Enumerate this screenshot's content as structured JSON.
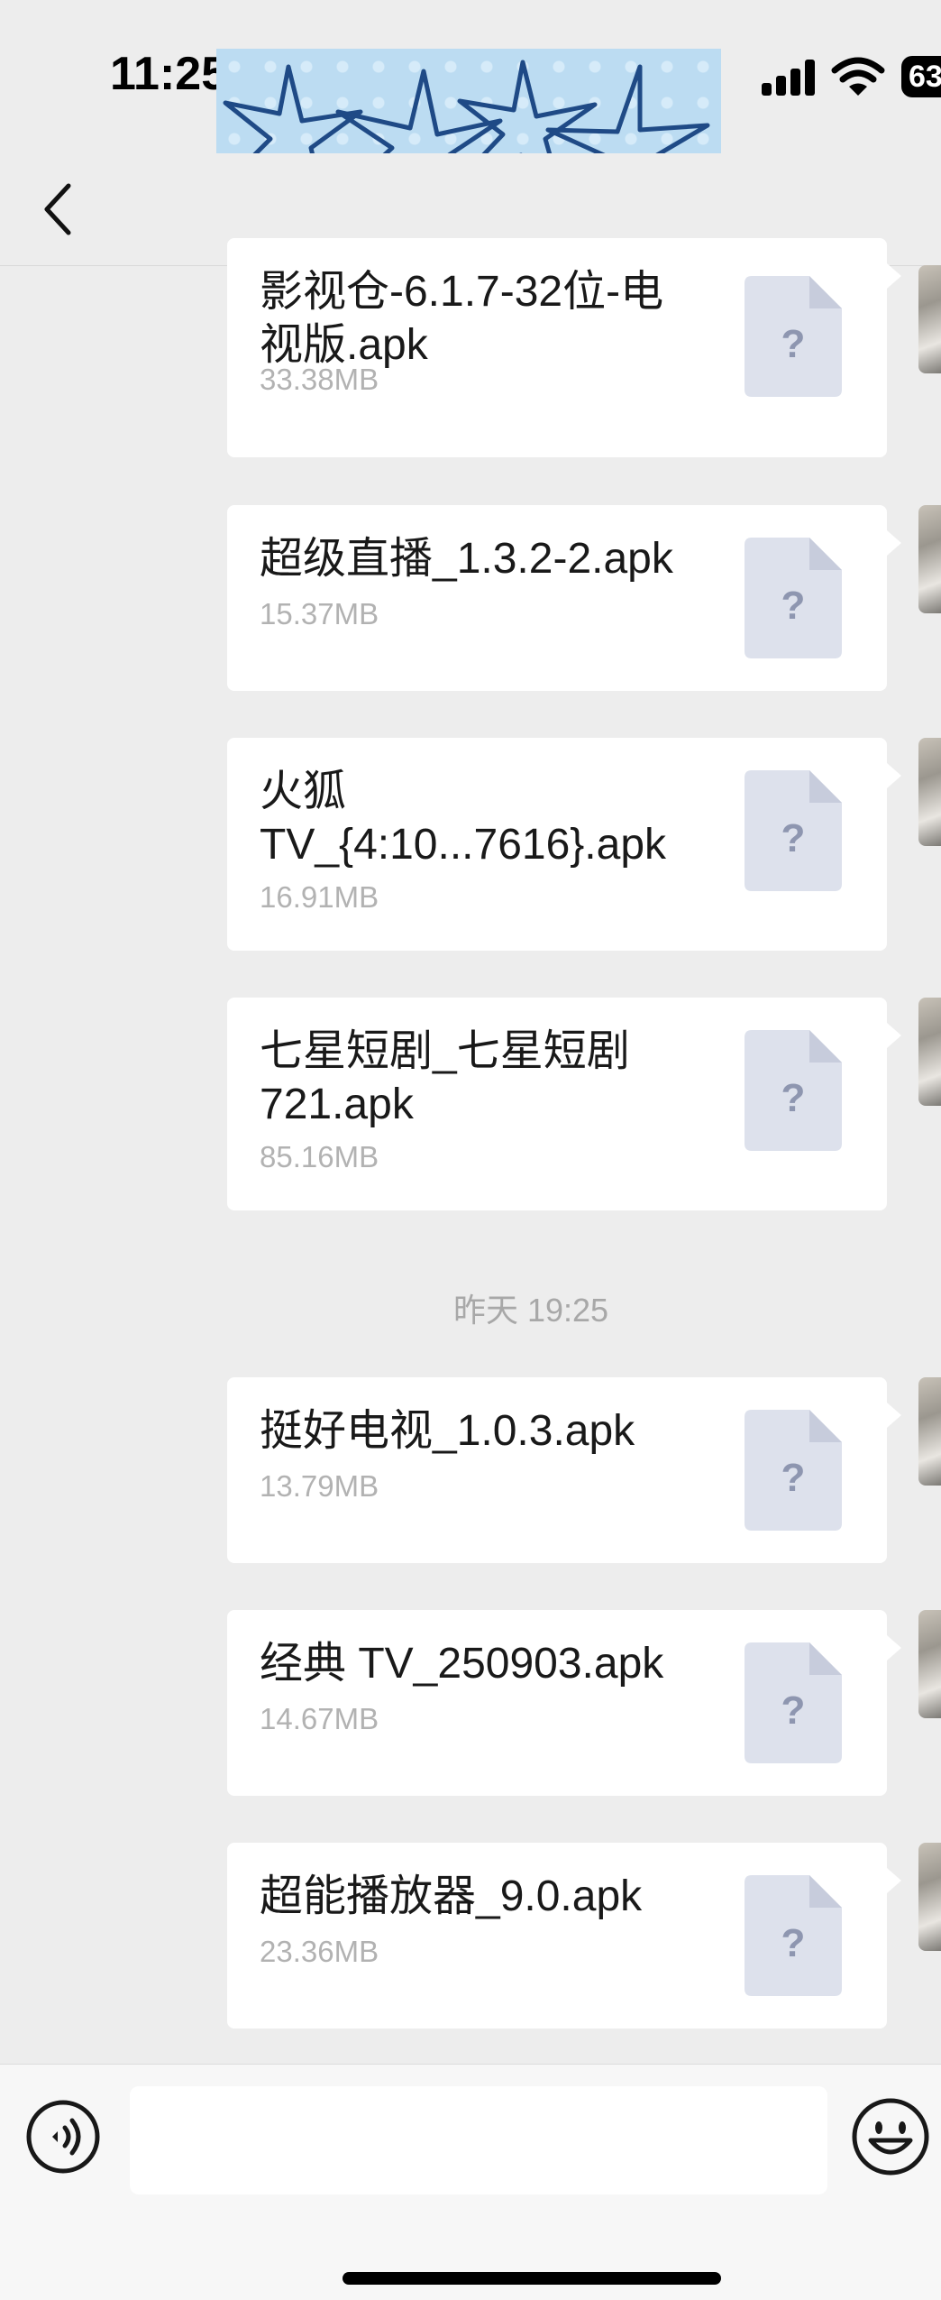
{
  "status_bar": {
    "time": "11:25",
    "battery_level": "63"
  },
  "nav": {
    "back_icon": "chevron-left-icon"
  },
  "messages": [
    {
      "name": "影视仓-6.1.7-32位-电视版.apk",
      "size": "33.38MB"
    },
    {
      "name": "超级直播_1.3.2-2.apk",
      "size": "15.37MB"
    },
    {
      "name": "火狐 TV_{4:10...7616}.apk",
      "size": "16.91MB"
    },
    {
      "name": "七星短剧_七星短剧721.apk",
      "size": "85.16MB"
    },
    {
      "name": "挺好电视_1.0.3.apk",
      "size": "13.79MB"
    },
    {
      "name": "经典 TV_250903.apk",
      "size": "14.67MB"
    },
    {
      "name": "超能播放器_9.0.apk",
      "size": "23.36MB"
    }
  ],
  "timestamp": "昨天 19:25",
  "file_icon_glyph": "?",
  "input_bar": {
    "voice_icon": "voice-icon",
    "emoji_icon": "emoji-icon",
    "input_value": ""
  }
}
